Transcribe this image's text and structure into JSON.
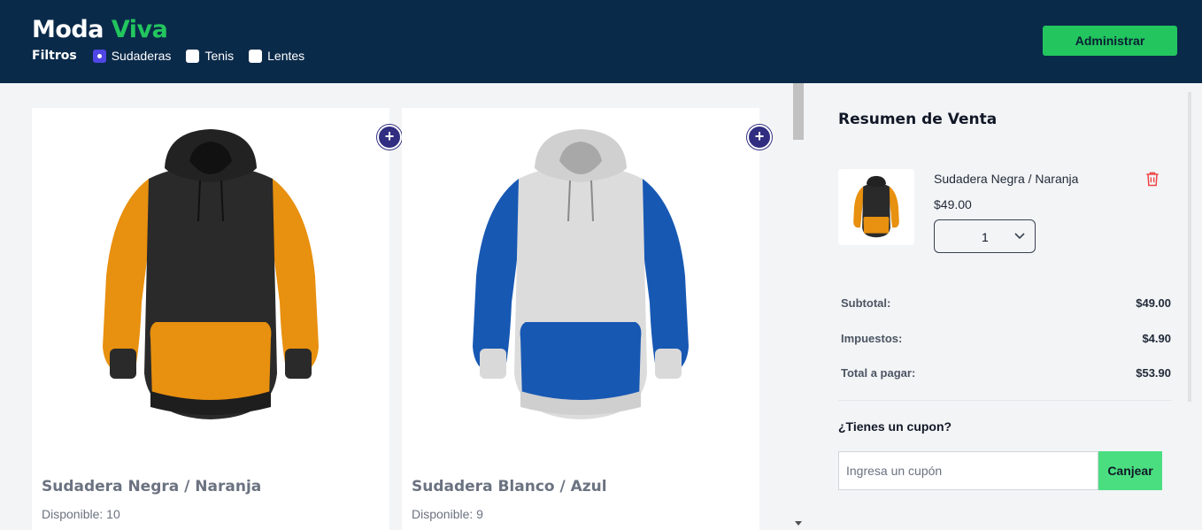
{
  "header": {
    "brand_main": "Moda",
    "brand_accent": "Viva",
    "filters_label": "Filtros",
    "filters": [
      {
        "label": "Sudaderas",
        "checked": true
      },
      {
        "label": "Tenis",
        "checked": false
      },
      {
        "label": "Lentes",
        "checked": false
      }
    ],
    "admin_label": "Administrar"
  },
  "products": [
    {
      "name": "Sudadera Negra / Naranja",
      "stock": "Disponible: 10",
      "body_color": "#2a2a2a",
      "accent_color": "#e8900f"
    },
    {
      "name": "Sudadera Blanco / Azul",
      "stock": "Disponible: 9",
      "body_color": "#d9d9d9",
      "accent_color": "#1758b3"
    }
  ],
  "summary": {
    "title": "Resumen de Venta",
    "item": {
      "name": "Sudadera Negra / Naranja",
      "price": "$49.00",
      "quantity": "1"
    },
    "subtotal_label": "Subtotal:",
    "subtotal_value": "$49.00",
    "tax_label": "Impuestos:",
    "tax_value": "$4.90",
    "total_label": "Total a pagar:",
    "total_value": "$53.90",
    "coupon_question": "¿Tienes un cupon?",
    "coupon_placeholder": "Ingresa un cupón",
    "coupon_button": "Canjear"
  },
  "colors": {
    "header_bg": "#0a2a4a",
    "accent_green": "#22c55e",
    "add_button": "#312e81",
    "trash_red": "#ef4444"
  }
}
